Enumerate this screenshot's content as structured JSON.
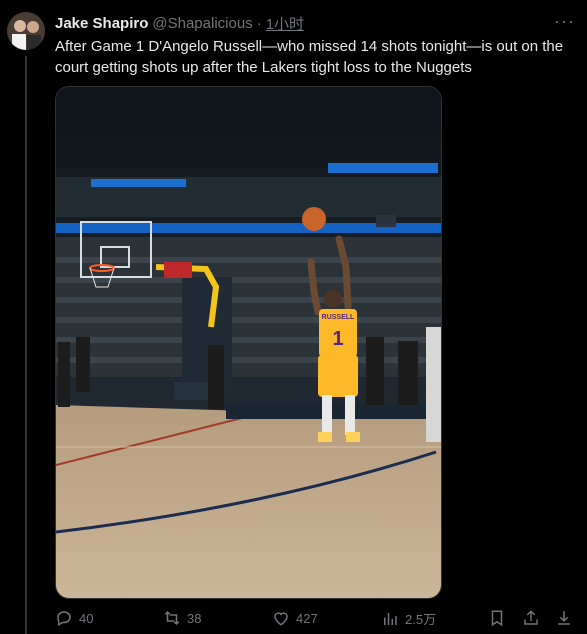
{
  "tweet": {
    "author_name": "Jake Shapiro",
    "handle": "@Shapalicious",
    "separator": "·",
    "timestamp": "1小时",
    "more_icon": "more-dots-icon",
    "text": "After Game 1 D'Angelo Russell—who missed 14 shots tonight—is out on the court getting shots up after the Lakers tight loss to the Nuggets"
  },
  "media": {
    "jersey_name": "RUSSELL",
    "jersey_number": "1"
  },
  "actions": {
    "replies": "40",
    "retweets": "38",
    "likes": "427",
    "views": "2.5万"
  },
  "colors": {
    "background": "#000000",
    "text_primary": "#e7e9ea",
    "text_secondary": "#71767b",
    "lakers_gold": "#fdb927"
  }
}
